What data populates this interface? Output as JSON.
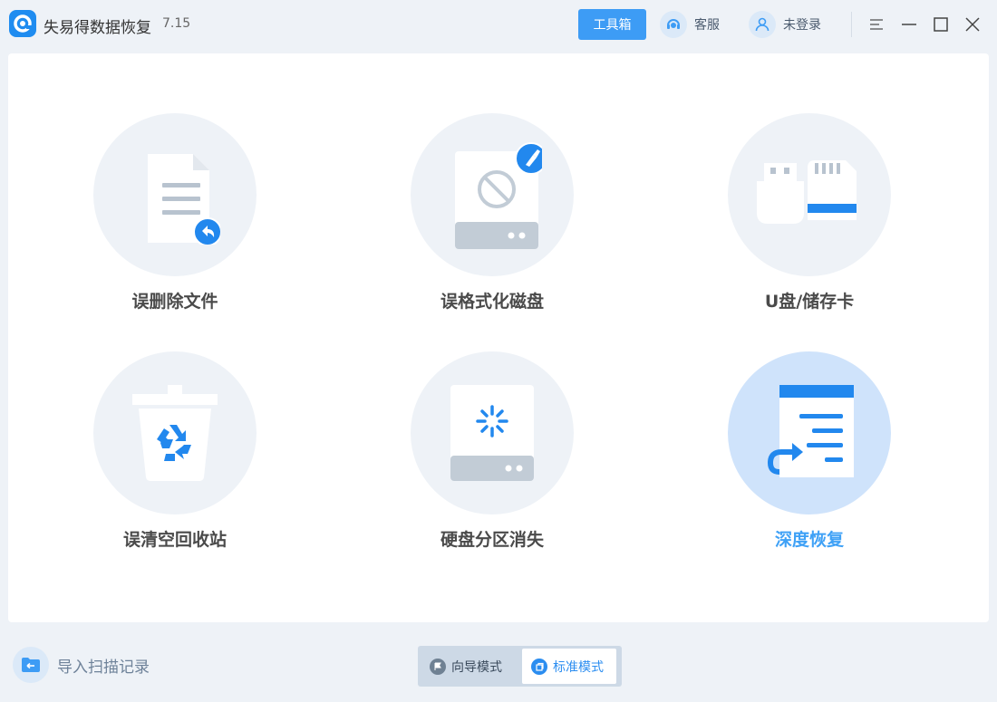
{
  "header": {
    "app_title": "失易得数据恢复",
    "version": "7.15",
    "toolbox_label": "工具箱",
    "service_label": "客服",
    "login_label": "未登录"
  },
  "tiles": [
    {
      "label": "误删除文件",
      "icon": "deleted-file-icon"
    },
    {
      "label": "误格式化磁盘",
      "icon": "formatted-disk-icon"
    },
    {
      "label": "U盘/储存卡",
      "icon": "usb-sdcard-icon"
    },
    {
      "label": "误清空回收站",
      "icon": "recycle-bin-icon"
    },
    {
      "label": "硬盘分区消失",
      "icon": "lost-partition-icon"
    },
    {
      "label": "深度恢复",
      "icon": "deep-recovery-icon",
      "active": true
    }
  ],
  "footer": {
    "import_label": "导入扫描记录",
    "modes": [
      {
        "label": "向导模式",
        "selected": false
      },
      {
        "label": "标准模式",
        "selected": true
      }
    ]
  },
  "colors": {
    "accent": "#3d9cf5",
    "active_label": "#3fa1f6",
    "background": "#eef2f7"
  }
}
